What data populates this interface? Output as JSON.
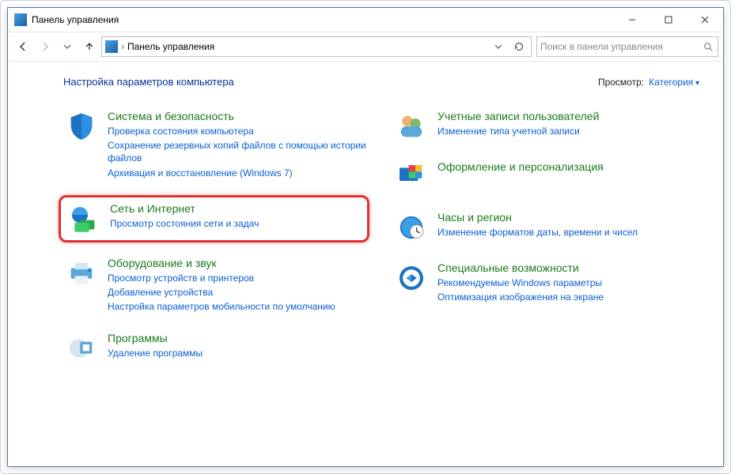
{
  "titlebar": {
    "title": "Панель управления"
  },
  "addressbar": {
    "path": "Панель управления"
  },
  "search": {
    "placeholder": "Поиск в панели управления"
  },
  "header": {
    "heading": "Настройка параметров компьютера",
    "view_by_label": "Просмотр:",
    "view_by_value": "Категория"
  },
  "categories": {
    "system": {
      "title": "Система и безопасность",
      "links": [
        "Проверка состояния компьютера",
        "Сохранение резервных копий файлов с помощью истории файлов",
        "Архивация и восстановление (Windows 7)"
      ]
    },
    "network": {
      "title": "Сеть и Интернет",
      "links": [
        "Просмотр состояния сети и задач"
      ]
    },
    "hardware": {
      "title": "Оборудование и звук",
      "links": [
        "Просмотр устройств и принтеров",
        "Добавление устройства",
        "Настройка параметров мобильности по умолчанию"
      ]
    },
    "programs": {
      "title": "Программы",
      "links": [
        "Удаление программы"
      ]
    },
    "accounts": {
      "title": "Учетные записи пользователей",
      "links": [
        "Изменение типа учетной записи"
      ]
    },
    "appearance": {
      "title": "Оформление и персонализация",
      "links": []
    },
    "clock": {
      "title": "Часы и регион",
      "links": [
        "Изменение форматов даты, времени и чисел"
      ]
    },
    "ease": {
      "title": "Специальные возможности",
      "links": [
        "Рекомендуемые Windows параметры",
        "Оптимизация изображения на экране"
      ]
    }
  }
}
